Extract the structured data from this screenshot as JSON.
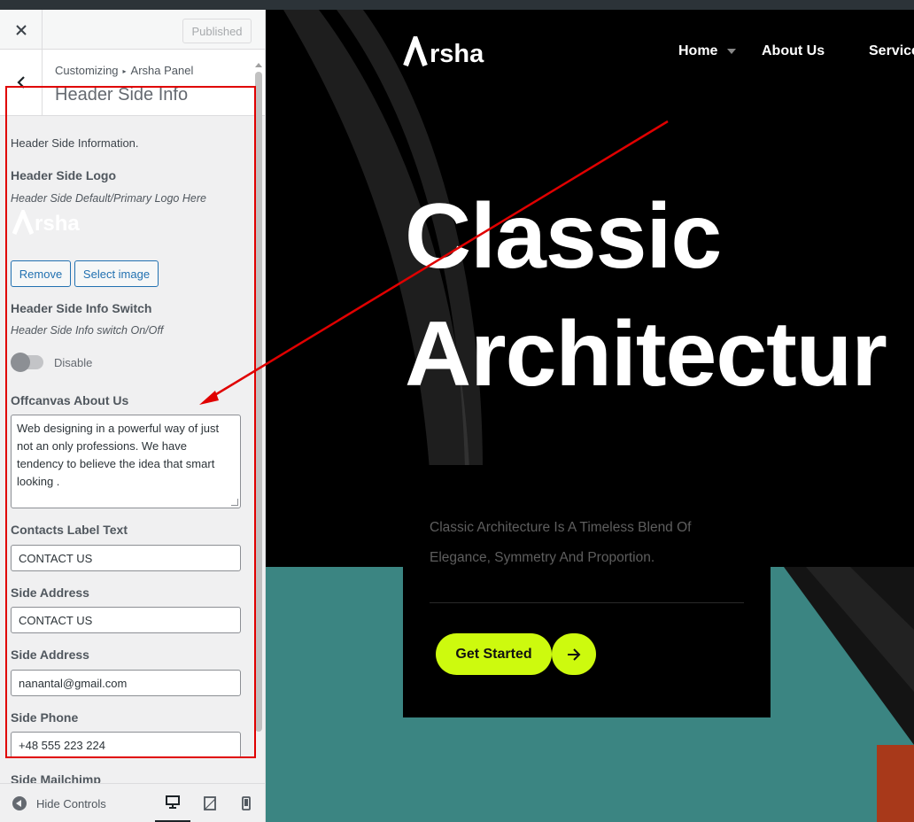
{
  "panel": {
    "published_label": "Published",
    "breadcrumb": {
      "part1": "Customizing",
      "part2": "Arsha Panel"
    },
    "section_title": "Header Side Info",
    "section_description": "Header Side Information.",
    "logo_control": {
      "title": "Header Side Logo",
      "description": "Header Side Default/Primary Logo Here",
      "logo_letter": "A",
      "logo_text": "rsha",
      "remove_label": "Remove",
      "select_label": "Select image"
    },
    "switch_control": {
      "title": "Header Side Info Switch",
      "description": "Header Side Info switch On/Off",
      "state_label": "Disable"
    },
    "about_control": {
      "title": "Offcanvas About Us",
      "value": "Web designing in a powerful way of just not an only professions. We have tendency to believe the idea that smart looking ."
    },
    "contacts_label_control": {
      "title": "Contacts Label Text",
      "value": "CONTACT US"
    },
    "address_control_1": {
      "title": "Side Address",
      "value": "CONTACT US"
    },
    "address_control_2": {
      "title": "Side Address",
      "value": "nanantal@gmail.com"
    },
    "phone_control": {
      "title": "Side Phone",
      "value": "+48 555 223 224"
    },
    "mailchimp_control": {
      "title": "Side Mailchimp"
    },
    "footer": {
      "hide_controls_label": "Hide Controls"
    }
  },
  "preview": {
    "logo_letter": "A",
    "logo_text": "rsha",
    "nav": {
      "home": "Home",
      "about": "About Us",
      "services": "Service"
    },
    "hero": {
      "line1": "Classic",
      "line2": "Architectur"
    },
    "card": {
      "text": "Classic Architecture Is A Timeless Blend Of Elegance, Symmetry And Proportion.",
      "cta_label": "Get Started"
    }
  },
  "colors": {
    "highlight": "#e00000",
    "wp_blue": "#2271b1",
    "cta_lime": "#cdfa0e",
    "teal": "#3b8582"
  },
  "icons": {
    "close": "close-icon",
    "back": "chevron-left-icon",
    "nav_dropdown": "caret-down-icon",
    "cta": "arrow-right-icon",
    "desktop": "desktop-icon",
    "tablet": "tablet-icon",
    "mobile": "mobile-icon"
  }
}
